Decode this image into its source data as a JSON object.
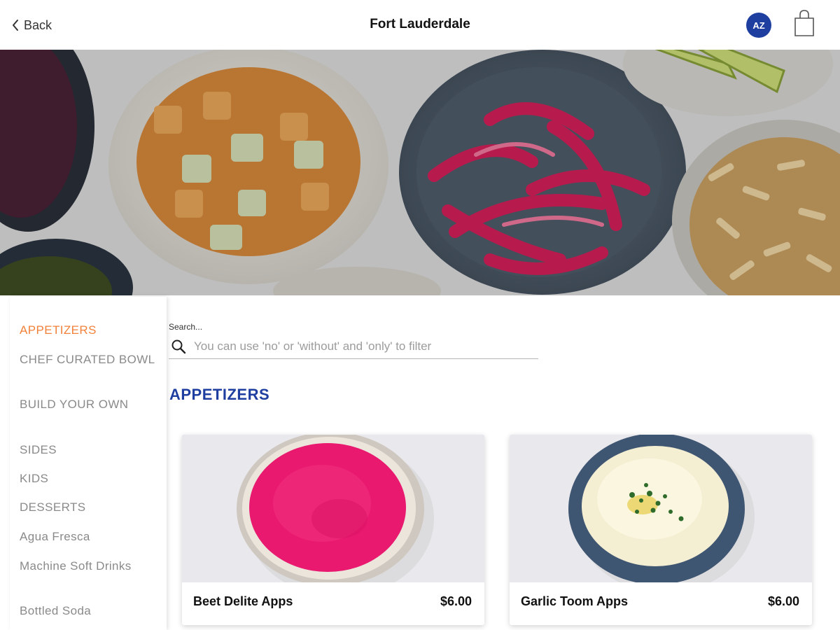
{
  "header": {
    "back_label": "Back",
    "title": "Fort Lauderdale",
    "avatar_initials": "AZ"
  },
  "sidebar": {
    "categories": [
      "APPETIZERS",
      "CHEF CURATED BOWL",
      "BUILD YOUR OWN",
      "SIDES",
      "KIDS",
      "DESSERTS",
      "Agua Fresca",
      "Machine Soft Drinks",
      "Bottled Soda"
    ],
    "active_category": "APPETIZERS"
  },
  "search": {
    "label": "Search...",
    "placeholder": "You can use 'no' or 'without' and 'only' to filter",
    "value": ""
  },
  "section": {
    "title": "APPETIZERS"
  },
  "items": [
    {
      "name": "Beet Delite Apps",
      "price": "$6.00"
    },
    {
      "name": "Garlic Toom Apps",
      "price": "$6.00"
    }
  ],
  "colors": {
    "accent_orange": "#f2813a",
    "brand_blue": "#1f3fa0",
    "muted_text": "#8a8a8a"
  },
  "icons": {
    "back": "chevron-left-icon",
    "cart": "shopping-bag-icon",
    "search": "search-icon"
  }
}
